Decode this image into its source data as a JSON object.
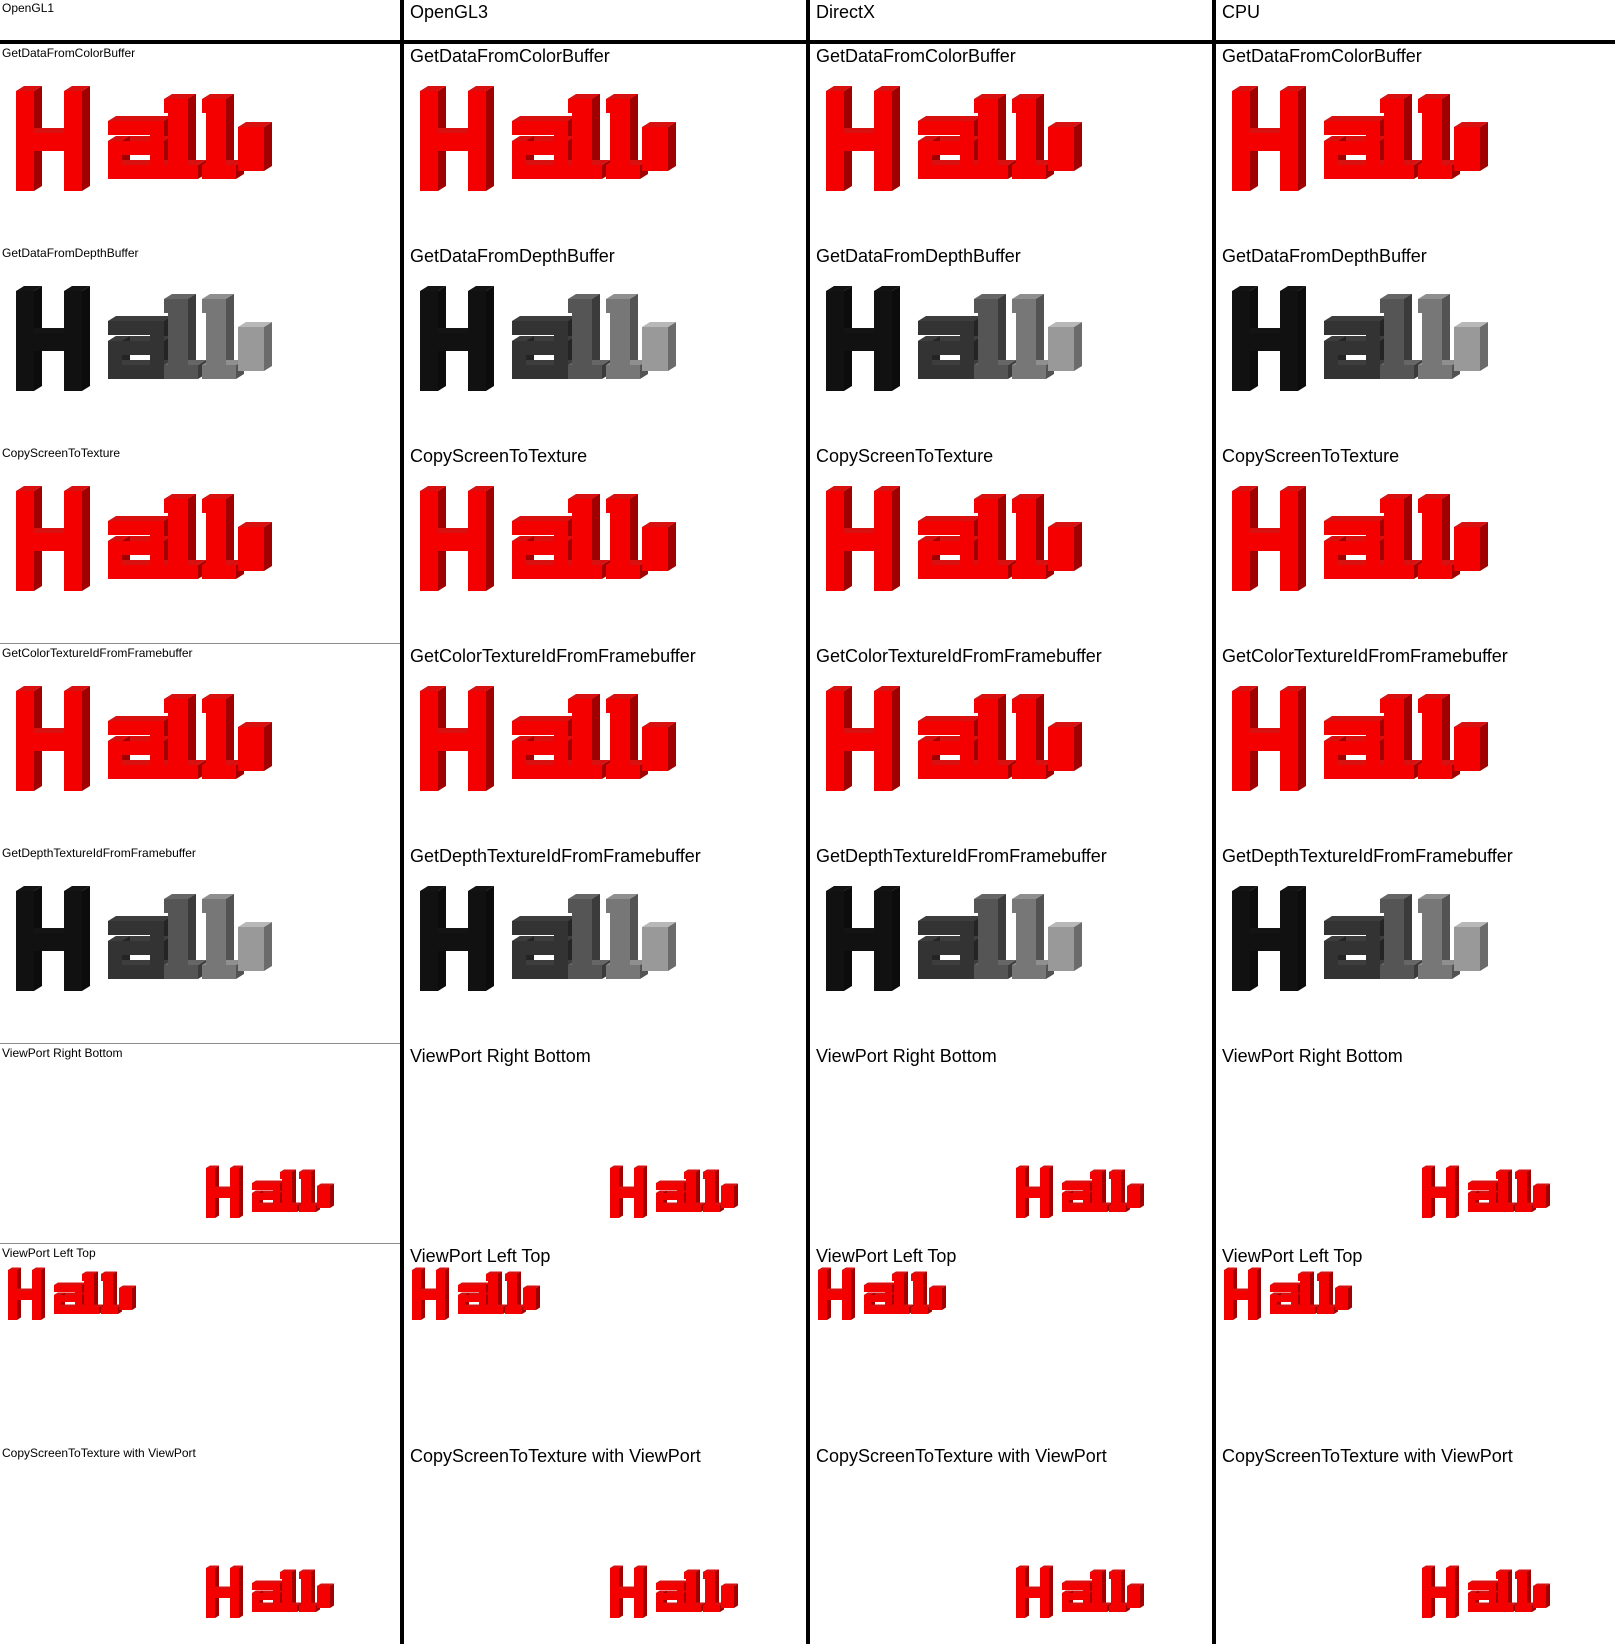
{
  "columns": [
    {
      "title": "OpenGL1",
      "label_size": "small"
    },
    {
      "title": "OpenGL3",
      "label_size": "large"
    },
    {
      "title": "DirectX",
      "label_size": "large"
    },
    {
      "title": "CPU",
      "label_size": "large"
    }
  ],
  "tests": [
    {
      "label": "GetDataFromColorBuffer",
      "render": "color",
      "placement": "full"
    },
    {
      "label": "GetDataFromDepthBuffer",
      "render": "depth",
      "placement": "full"
    },
    {
      "label": "CopyScreenToTexture",
      "render": "color",
      "placement": "full"
    },
    {
      "label": "GetColorTextureIdFromFramebuffer",
      "render": "color",
      "placement": "full"
    },
    {
      "label": "GetDepthTextureIdFromFramebuffer",
      "render": "depth",
      "placement": "full"
    },
    {
      "label": "ViewPort Right Bottom",
      "render": "color",
      "placement": "right-bottom"
    },
    {
      "label": "ViewPort Left Top",
      "render": "color",
      "placement": "left-top"
    },
    {
      "label": "CopyScreenToTexture with ViewPort",
      "render": "color",
      "placement": "right-bottom"
    }
  ],
  "colors": {
    "background": "#ffffff",
    "grid_line": "#000000",
    "separator": "#8c8c8c",
    "red_front": "#f50000",
    "red_side": "#a00000",
    "red_top": "#d81010",
    "depth_front_H": "#111111",
    "depth_front_a": "#333333",
    "depth_front_l1": "#555555",
    "depth_front_l2": "#777777",
    "depth_front_o": "#999999"
  }
}
